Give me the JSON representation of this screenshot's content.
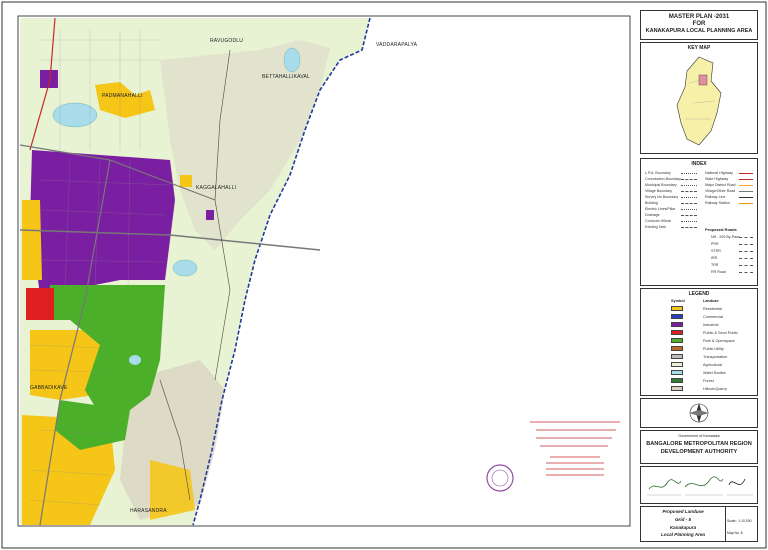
{
  "map_labels": {
    "ravugodlu": "RAVUGODLU",
    "vaddarapalya": "VADDARAPALYA",
    "bettahalli": "BETTAHALLIKAVAL",
    "kaggalahalli": "KAGGALAHALLI",
    "gabbadi": "GABBADIKAVE",
    "harasandra": "HARASANDRA",
    "padmana": "PADMANAHALLI"
  },
  "title": {
    "line1": "MASTER PLAN -2031",
    "line2": "FOR",
    "line3": "KANAKAPURA LOCAL PLANNING AREA"
  },
  "keymap": {
    "heading": "KEY MAP"
  },
  "index": {
    "heading": "INDEX",
    "left": [
      "L.P.A. Boundary",
      "Conurbation Boundary",
      "Municipal Boundary",
      "Village Boundary",
      "Survey No Boundary",
      "Building",
      "Electric Lines/Pillar",
      "Drainage",
      "Contours Hillock",
      "Existing Tank"
    ],
    "right": [
      "National Highway",
      "State Highway",
      "Major District Road",
      "Village/Other Road",
      "Railway Line",
      "Railway Station"
    ],
    "proposed_heading": "Proposed Roads",
    "proposed": [
      "NH - 209 By-Pass",
      "PRR",
      "STRR",
      "IRR",
      "TRR",
      "RR Road"
    ]
  },
  "legend": {
    "heading": "LEGEND",
    "col_symbol": "Symbol",
    "col_landuse": "Landuse",
    "items": [
      {
        "label": "Residential",
        "color": "#f5c518"
      },
      {
        "label": "Commercial",
        "color": "#2a3fbf"
      },
      {
        "label": "Industrial",
        "color": "#7b1fa2"
      },
      {
        "label": "Public & Semi Public",
        "color": "#e02020"
      },
      {
        "label": "Park & Openspace",
        "color": "#4caf2a"
      },
      {
        "label": "Public Utility",
        "color": "#b86a2a"
      },
      {
        "label": "Transportation",
        "color": "#bdbdbd"
      },
      {
        "label": "Agricultural",
        "color": "#e8f3d4"
      },
      {
        "label": "Water Bodies",
        "color": "#a8dcea"
      },
      {
        "label": "Forest",
        "color": "#2e7d32"
      },
      {
        "label": "Hillock/Quarry",
        "color": "#d9cfc0"
      }
    ]
  },
  "authority": {
    "govt": "Government of Karnataka",
    "name1": "BANGALORE METROPOLITAN REGION",
    "name2": "DEVELOPMENT AUTHORITY"
  },
  "footer": {
    "proposed_landuse": "Proposed Landuse",
    "grid": "Grid - 5",
    "place1": "Kanakapura",
    "place2": "Local Planning Area",
    "scale": "Scale : 1:10,000",
    "sheet": "Map No.:5"
  },
  "colors": {
    "agri": "#e8f3d4",
    "residential": "#f5c518",
    "industrial": "#7b1fa2",
    "park": "#4caf2a",
    "public": "#e02020",
    "water": "#a8dcea",
    "boundary": "#1e3a9e"
  }
}
